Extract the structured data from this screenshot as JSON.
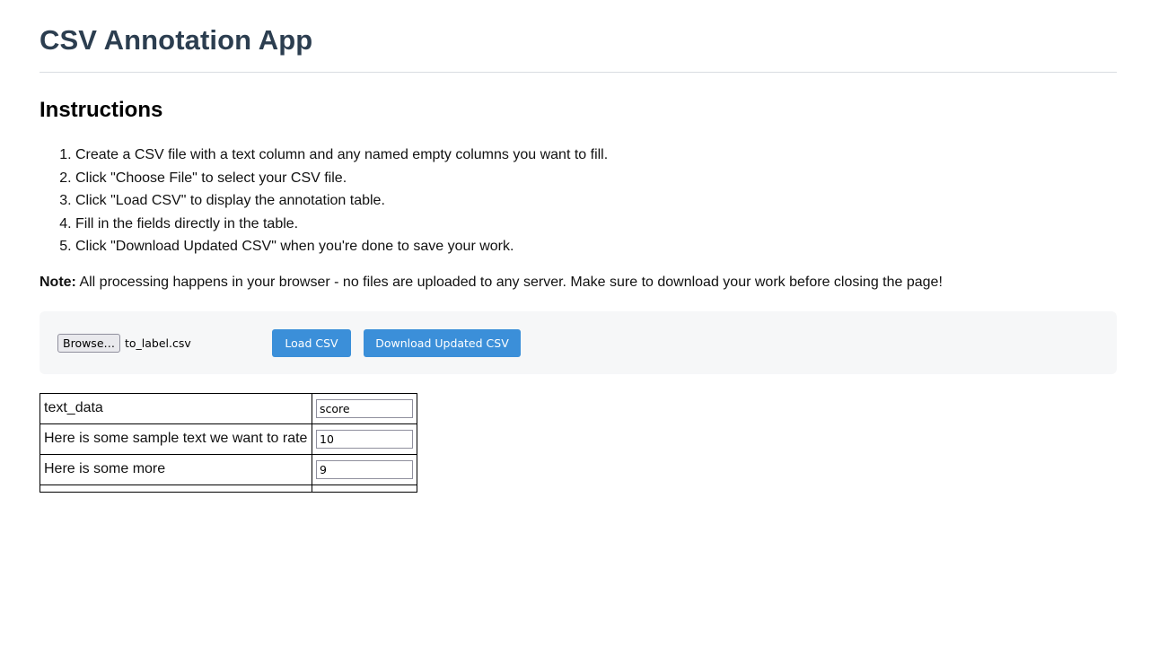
{
  "header": {
    "title": "CSV Annotation App"
  },
  "instructions": {
    "heading": "Instructions",
    "steps": [
      "Create a CSV file with a text column and any named empty columns you want to fill.",
      "Click \"Choose File\" to select your CSV file.",
      "Click \"Load CSV\" to display the annotation table.",
      "Fill in the fields directly in the table.",
      "Click \"Download Updated CSV\" when you're done to save your work."
    ],
    "note_label": "Note:",
    "note_text": " All processing happens in your browser - no files are uploaded to any server. Make sure to download your work before closing the page!"
  },
  "controls": {
    "browse_label": "Browse…",
    "file_name": "to_label.csv",
    "load_label": "Load CSV",
    "download_label": "Download Updated CSV"
  },
  "table": {
    "rows": [
      {
        "text": "text_data",
        "value": "score"
      },
      {
        "text": "Here is some sample text we want to rate",
        "value": "10"
      },
      {
        "text": "Here is some more",
        "value": "9"
      }
    ]
  },
  "colors": {
    "title": "#2c3e50",
    "button": "#3b8fd9",
    "panel": "#f6f7f8"
  }
}
